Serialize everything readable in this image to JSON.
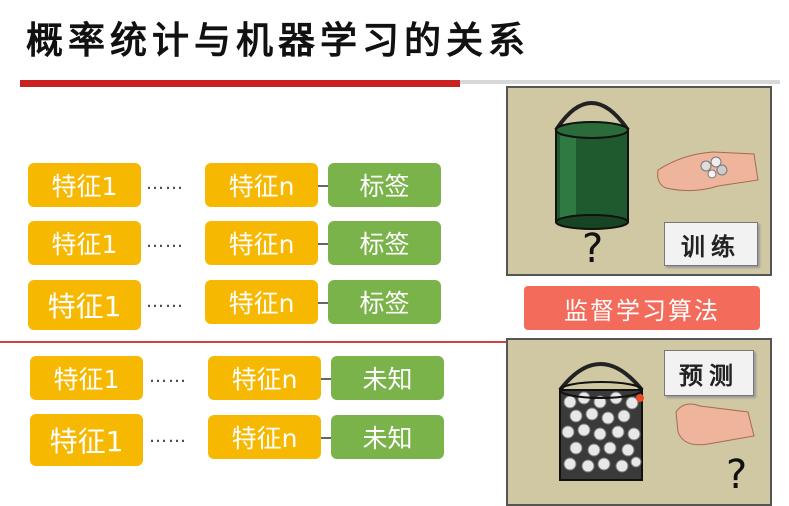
{
  "title": "概率统计与机器学习的关系",
  "rows": [
    {
      "first": "特征1",
      "dots": "……",
      "last": "特征n",
      "label": "标签",
      "kind": "known"
    },
    {
      "first": "特征1",
      "dots": "……",
      "last": "特征n",
      "label": "标签",
      "kind": "known"
    },
    {
      "first": "特征1",
      "dots": "……",
      "last": "特征n",
      "label": "标签",
      "kind": "known"
    },
    {
      "first": "特征1",
      "dots": "……",
      "last": "特征n",
      "label": "未知",
      "kind": "unknown"
    },
    {
      "first": "特征1",
      "dots": "……",
      "last": "特征n",
      "label": "未知",
      "kind": "unknown"
    }
  ],
  "right": {
    "train_label": "训练",
    "algo_label": "监督学习算法",
    "predict_label": "预测",
    "question_mark": "?"
  },
  "colors": {
    "feature": "#f6b800",
    "label": "#7ab34a",
    "algo": "#f26b5b",
    "accent": "#c8201f"
  }
}
